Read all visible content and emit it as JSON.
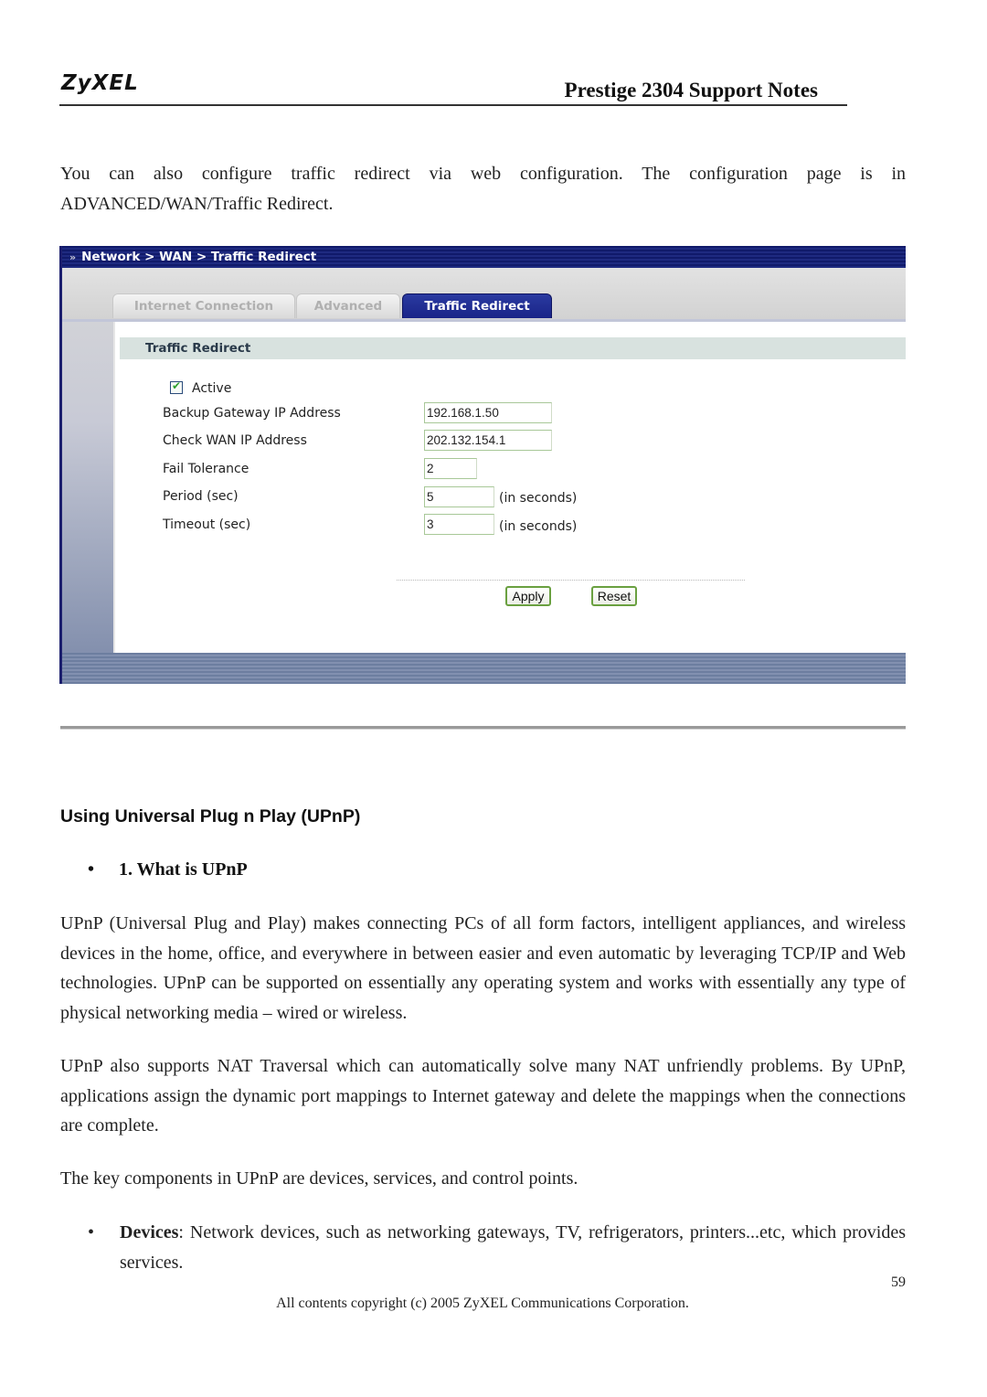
{
  "header": {
    "logo": "ZyXEL",
    "title": "Prestige 2304 Support Notes"
  },
  "intro": {
    "line1": "You can also configure traffic redirect via web configuration. The configuration page is in",
    "line2": "ADVANCED/WAN/Traffic Redirect."
  },
  "screenshot": {
    "breadcrumb": "Network > WAN > Traffic Redirect",
    "breadcrumb_icon": "double-arrow-icon",
    "tabs": [
      {
        "label": "Internet Connection",
        "active": false
      },
      {
        "label": "Advanced",
        "active": false
      },
      {
        "label": "Traffic Redirect",
        "active": true
      }
    ],
    "section_title": "Traffic Redirect",
    "active": {
      "label": "Active",
      "checked": true
    },
    "fields": [
      {
        "label": "Backup Gateway IP Address",
        "value": "192.168.1.50",
        "unit": ""
      },
      {
        "label": "Check WAN IP Address",
        "value": "202.132.154.1",
        "unit": ""
      },
      {
        "label": "Fail Tolerance",
        "value": "2",
        "unit": ""
      },
      {
        "label": "Period (sec)",
        "value": "5",
        "unit": "(in seconds)"
      },
      {
        "label": "Timeout (sec)",
        "value": "3",
        "unit": "(in seconds)"
      }
    ],
    "buttons": {
      "apply": "Apply",
      "reset": "Reset"
    },
    "colors": {
      "title_bar": "#1a2480",
      "active_tab": "#22309a",
      "button_border": "#6aa040"
    }
  },
  "upnp": {
    "heading": "Using Universal Plug n Play (UPnP)",
    "subheading_bullet": "•",
    "subheading": "1. What is UPnP",
    "paragraphs": [
      "UPnP (Universal Plug and Play) makes connecting PCs of all form factors, intelligent appliances, and wireless devices in the home, office, and everywhere in between easier and even automatic by leveraging TCP/IP and Web technologies. UPnP can be supported on essentially any operating system and works with essentially any type of physical networking media – wired or wireless.",
      "UPnP also supports NAT Traversal which can automatically solve many NAT unfriendly problems. By UPnP, applications assign the dynamic port mappings to Internet gateway and delete the mappings when the connections are complete.",
      "The key components in UPnP are devices, services, and control points."
    ],
    "bullets": [
      {
        "term": "Devices",
        "text": ": Network devices, such as networking gateways, TV, refrigerators, printers...etc, which provides services."
      }
    ]
  },
  "footer": {
    "page_number": "59",
    "copyright": "All contents copyright (c) 2005 ZyXEL Communications Corporation."
  }
}
